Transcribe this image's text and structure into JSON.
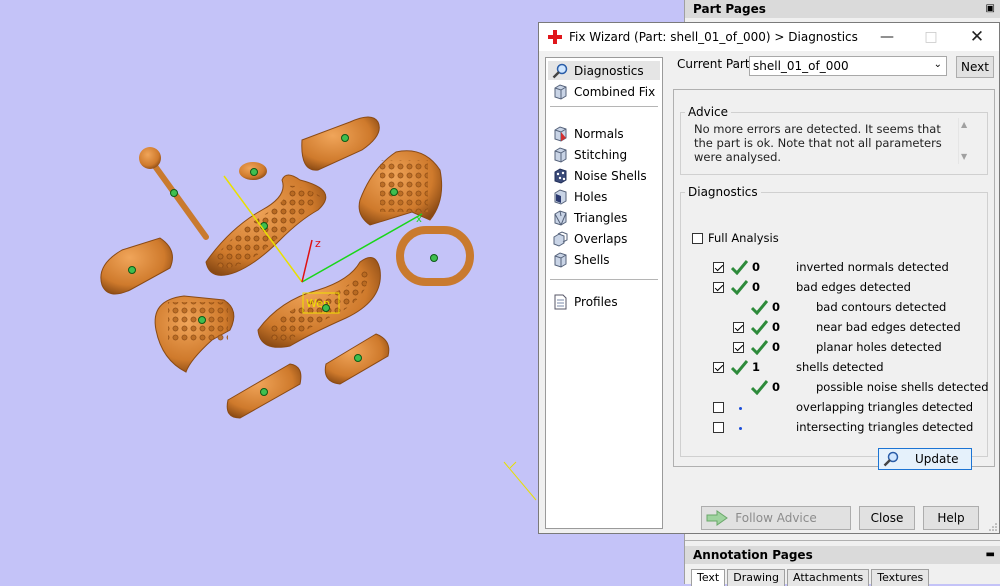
{
  "window": {
    "title": "Fix Wizard (Part: shell_01_of_000) > Diagnostics",
    "minimize_icon": "minimize-icon",
    "maximize_icon": "maximize-icon",
    "close_icon": "close-icon"
  },
  "side_panel": {
    "part_pages_title": "Part Pages",
    "annotation_pages_title": "Annotation Pages",
    "tabs": [
      "Text",
      "Drawing",
      "Attachments",
      "Textures"
    ],
    "active_tab": "Text"
  },
  "viewport": {
    "axis_z_label": "z",
    "axis_x_label": "x",
    "selection_label": "Wep"
  },
  "nav": {
    "items": [
      {
        "label": "Diagnostics",
        "icon": "magnifier-icon"
      },
      {
        "label": "Combined Fix",
        "icon": "cube-icon"
      },
      {
        "label": "Normals",
        "icon": "normals-cube-icon"
      },
      {
        "label": "Stitching",
        "icon": "stitching-cube-icon"
      },
      {
        "label": "Noise Shells",
        "icon": "noise-shells-icon"
      },
      {
        "label": "Holes",
        "icon": "holes-cube-icon"
      },
      {
        "label": "Triangles",
        "icon": "triangles-icon"
      },
      {
        "label": "Overlaps",
        "icon": "overlaps-icon"
      },
      {
        "label": "Shells",
        "icon": "shells-icon"
      },
      {
        "label": "Profiles",
        "icon": "profiles-icon"
      }
    ],
    "selected": "Diagnostics"
  },
  "current_part": {
    "label": "Current Part:",
    "value": "shell_01_of_000",
    "next_label": "Next"
  },
  "advice": {
    "legend": "Advice",
    "text": "No more errors are detected. It seems that the part is ok. Note that not all parameters were analysed."
  },
  "diagnostics": {
    "legend": "Diagnostics",
    "full_analysis_label": "Full Analysis",
    "full_analysis_checked": false,
    "rows": [
      {
        "checked": true,
        "status": "ok",
        "count": "0",
        "label": "inverted normals detected"
      },
      {
        "checked": true,
        "status": "ok",
        "count": "0",
        "label": "bad edges detected"
      },
      {
        "checked": null,
        "status": "ok",
        "count": "0",
        "label": "bad contours detected"
      },
      {
        "checked": true,
        "status": "ok",
        "count": "0",
        "label": "near bad edges detected"
      },
      {
        "checked": true,
        "status": "ok",
        "count": "0",
        "label": "planar holes detected"
      },
      {
        "checked": true,
        "status": "ok",
        "count": "1",
        "label": "shells detected"
      },
      {
        "checked": null,
        "status": "ok",
        "count": "0",
        "label": "possible noise shells detected"
      },
      {
        "checked": false,
        "status": "none",
        "count": "",
        "label": "overlapping triangles detected"
      },
      {
        "checked": false,
        "status": "none",
        "count": "",
        "label": "intersecting triangles detected"
      }
    ],
    "update_label": "Update"
  },
  "buttons": {
    "follow_advice": "Follow Advice",
    "close": "Close",
    "help": "Help"
  },
  "colors": {
    "viewport_bg": "#c4c3f8",
    "part_orange": "#d4822f",
    "check_green": "#2e8b3b"
  }
}
